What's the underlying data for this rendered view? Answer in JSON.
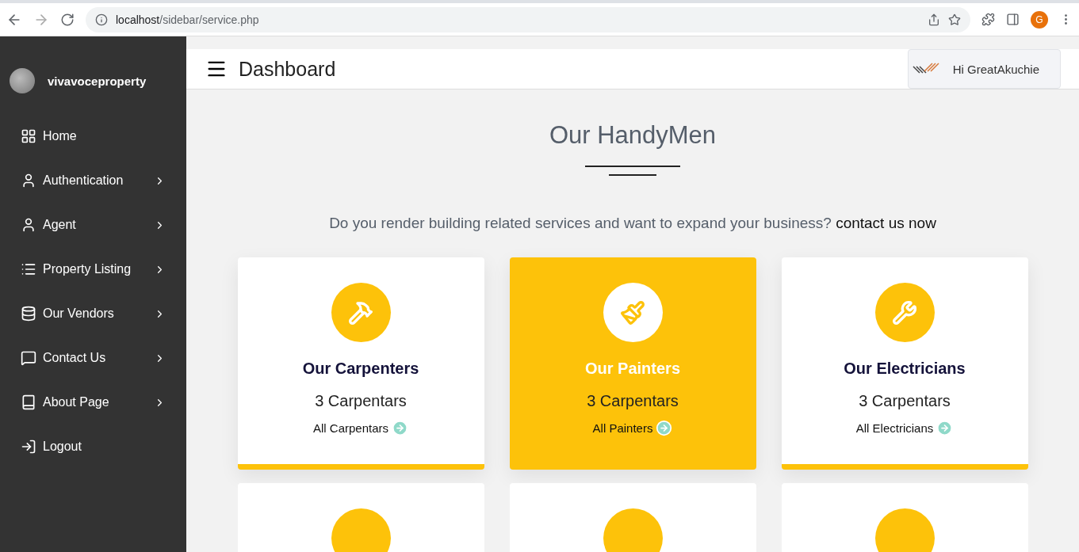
{
  "browser": {
    "url_host": "localhost",
    "url_path": "/sidebar/service.php",
    "profile_initial": "G"
  },
  "sidebar": {
    "brand": "vivavoceproperty",
    "items": [
      {
        "label": "Home",
        "has_submenu": false
      },
      {
        "label": "Authentication",
        "has_submenu": true
      },
      {
        "label": "Agent",
        "has_submenu": true
      },
      {
        "label": "Property Listing",
        "has_submenu": true
      },
      {
        "label": "Our Vendors",
        "has_submenu": true
      },
      {
        "label": "Contact Us",
        "has_submenu": true
      },
      {
        "label": "About Page",
        "has_submenu": true
      },
      {
        "label": "Logout",
        "has_submenu": false
      }
    ]
  },
  "header": {
    "title": "Dashboard",
    "greeting": "Hi GreatAkuchie"
  },
  "section": {
    "title": "Our HandyMen",
    "intro": "Do you render building related services and want to expand your business?",
    "intro_link": "contact us now"
  },
  "cards": [
    {
      "title": "Our Carpenters",
      "count": "3 Carpentars",
      "link": "All Carpentars",
      "highlighted": false
    },
    {
      "title": "Our Painters",
      "count": "3 Carpentars",
      "link": "All Painters",
      "highlighted": true
    },
    {
      "title": "Our Electricians",
      "count": "3 Carpentars",
      "link": "All Electricians",
      "highlighted": false
    }
  ],
  "more_cards": [
    {
      "kind": "stub"
    },
    {
      "kind": "stub"
    },
    {
      "kind": "stub"
    }
  ]
}
